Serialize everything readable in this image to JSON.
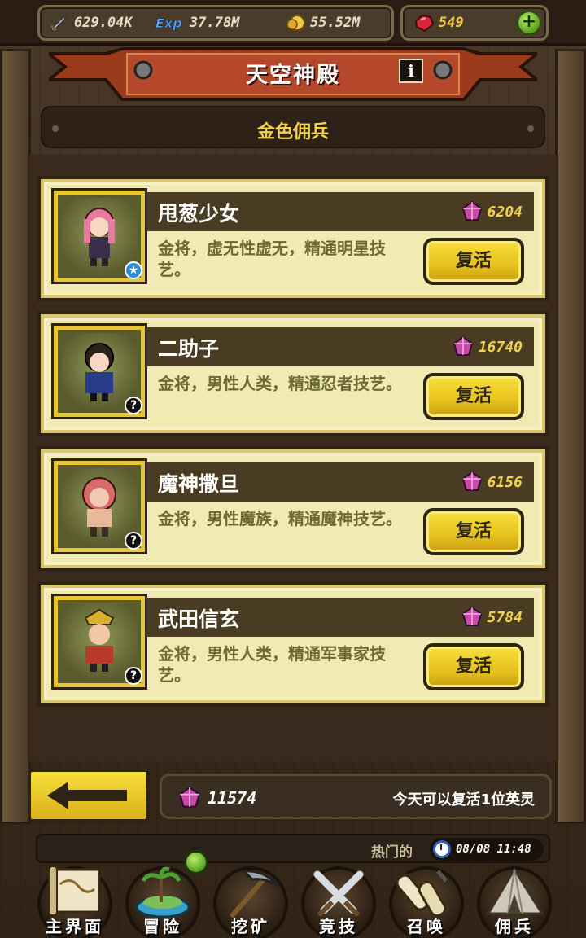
{
  "resources": {
    "attack": {
      "icon": "sword-icon",
      "value": "629.04K"
    },
    "exp": {
      "icon": "exp-icon",
      "value": "37.78M"
    },
    "gold": {
      "icon": "coin-icon",
      "value": "55.52M"
    },
    "gems": {
      "icon": "ruby-icon",
      "value": "549"
    },
    "add_button": "+"
  },
  "title": "天空神殿",
  "info_button": "i",
  "subtitle": "金色佣兵",
  "heroes": [
    {
      "name": "甩葱少女",
      "cost": "6204",
      "desc": "金将，虚无性虚无，精通明星技艺。",
      "badge": "★",
      "button": "复活"
    },
    {
      "name": "二助子",
      "cost": "16740",
      "desc": "金将，男性人类，精通忍者技艺。",
      "badge": "?",
      "button": "复活"
    },
    {
      "name": "魔神撒旦",
      "cost": "6156",
      "desc": "金将，男性魔族，精通魔神技艺。",
      "badge": "?",
      "button": "复活"
    },
    {
      "name": "武田信玄",
      "cost": "5784",
      "desc": "金将，男性人类，精通军事家技艺。",
      "badge": "?",
      "button": "复活"
    }
  ],
  "footer": {
    "balance": "11574",
    "revive_info": "今天可以复活1位英灵"
  },
  "ticker": {
    "text": "热门的",
    "time": "08/08 11:48"
  },
  "nav": [
    {
      "label": "主界面",
      "icon": "scroll-map-icon"
    },
    {
      "label": "冒险",
      "icon": "island-icon"
    },
    {
      "label": "挖矿",
      "icon": "pickaxe-icon"
    },
    {
      "label": "竞技",
      "icon": "crossed-swords-icon"
    },
    {
      "label": "召唤",
      "icon": "summon-scroll-icon"
    },
    {
      "label": "佣兵",
      "icon": "tent-icon"
    }
  ]
}
